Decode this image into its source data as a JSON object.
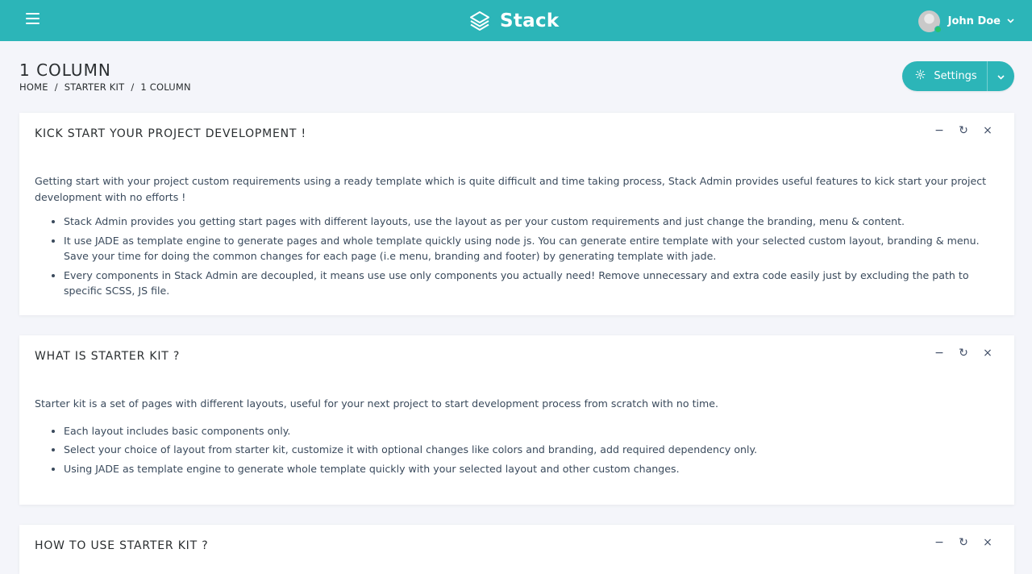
{
  "header": {
    "brand": "Stack",
    "user_name": "John Doe",
    "menu_icon": "hamburger-icon",
    "brand_icon": "stack-layers-icon",
    "accent_color": "#2cb5b8"
  },
  "page": {
    "title": "1 COLUMN",
    "breadcrumb": [
      "HOME",
      "STARTER KIT",
      "1 COLUMN"
    ],
    "breadcrumb_sep": "/"
  },
  "settings": {
    "label": "Settings",
    "icon": "gear-icon"
  },
  "card_tools": {
    "minimize": "−",
    "reload": "↻",
    "close": "×"
  },
  "cards": [
    {
      "title": "KICK START YOUR PROJECT DEVELOPMENT !",
      "intro": "Getting start with your project custom requirements using a ready template which is quite difficult and time taking process, Stack Admin provides useful features to kick start your project development with no efforts !",
      "items": [
        "Stack Admin provides you getting start pages with different layouts, use the layout as per your custom requirements and just change the branding, menu & content.",
        "It use JADE as template engine to generate pages and whole template quickly using node js. You can generate entire template with your selected custom layout, branding & menu. Save your time for doing the common changes for each page (i.e menu, branding and footer) by generating template with jade.",
        "Every components in Stack Admin are decoupled, it means use use only components you actually need! Remove unnecessary and extra code easily just by excluding the path to specific SCSS, JS file."
      ]
    },
    {
      "title": "WHAT IS STARTER KIT ?",
      "intro": "Starter kit is a set of pages with different layouts, useful for your next project to start development process from scratch with no time.",
      "items": [
        "Each layout includes basic components only.",
        "Select your choice of layout from starter kit, customize it with optional changes like colors and branding, add required dependency only.",
        "Using JADE as template engine to generate whole template quickly with your selected layout and other custom changes."
      ]
    },
    {
      "title": "HOW TO USE STARTER KIT ?"
    }
  ]
}
